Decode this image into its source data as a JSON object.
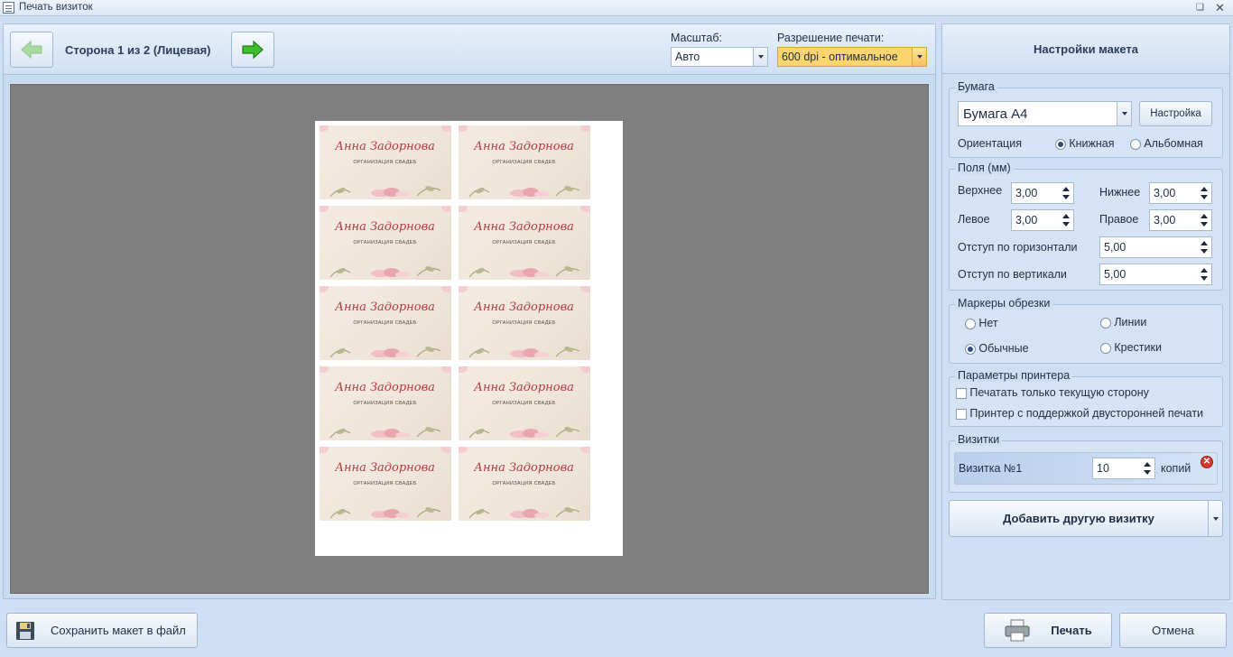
{
  "window": {
    "title": "Печать визиток"
  },
  "toolbar": {
    "side_label": "Сторона 1 из 2 (Лицевая)",
    "scale_label": "Масштаб:",
    "scale_value": "Авто",
    "resolution_label": "Разрешение печати:",
    "resolution_value": "600 dpi - оптимальное"
  },
  "preview": {
    "card_name": "Анна Задорнова",
    "card_subtitle": "ОРГАНИЗАЦИЯ СВАДЕБ"
  },
  "settings": {
    "header": "Настройки макета",
    "paper": {
      "group_title": "Бумага",
      "paper_value": "Бумага А4",
      "setup_button": "Настройка",
      "orientation_label": "Ориентация",
      "portrait": "Книжная",
      "landscape": "Альбомная"
    },
    "margins": {
      "group_title": "Поля (мм)",
      "top_label": "Верхнее",
      "top_value": "3,00",
      "bottom_label": "Нижнее",
      "bottom_value": "3,00",
      "left_label": "Левое",
      "left_value": "3,00",
      "right_label": "Правое",
      "right_value": "3,00",
      "hgap_label": "Отступ по горизонтали",
      "hgap_value": "5,00",
      "vgap_label": "Отступ по вертикали",
      "vgap_value": "5,00"
    },
    "marks": {
      "group_title": "Маркеры обрезки",
      "none": "Нет",
      "lines": "Линии",
      "normal": "Обычные",
      "crosses": "Крестики"
    },
    "printer": {
      "group_title": "Параметры принтера",
      "current_side_only": "Печатать только текущую сторону",
      "duplex": "Принтер с поддержкой двусторонней печати"
    },
    "cards": {
      "group_title": "Визитки",
      "card_name": "Визитка №1",
      "copies_value": "10",
      "copies_label": "копий",
      "add_button": "Добавить другую визитку"
    }
  },
  "footer": {
    "save_button": "Сохранить макет в файл",
    "print_button": "Печать",
    "cancel_button": "Отмена"
  }
}
